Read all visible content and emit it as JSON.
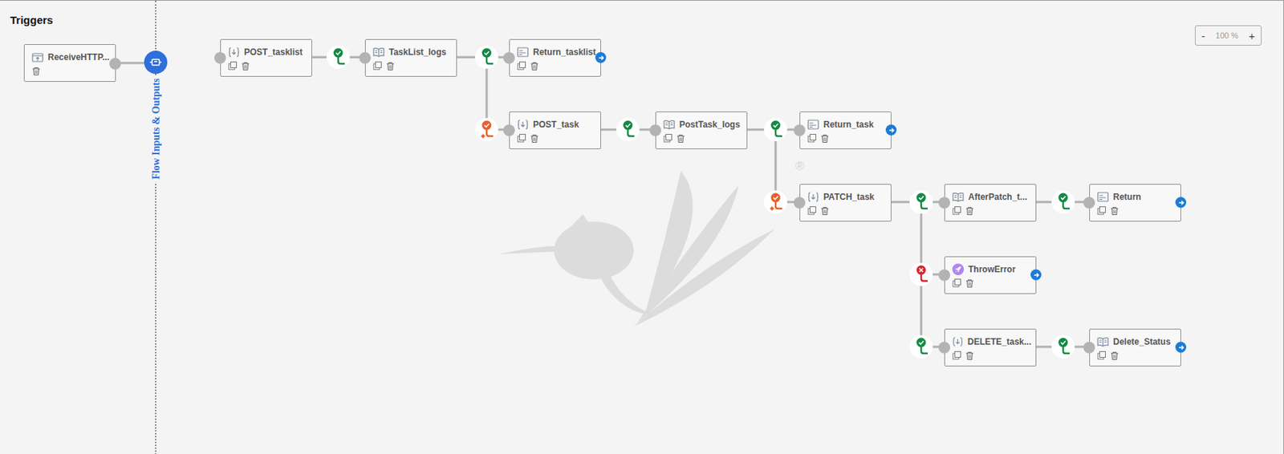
{
  "triggers": {
    "title": "Triggers",
    "items": [
      {
        "label": "ReceiveHTTP..."
      }
    ]
  },
  "flow_io": {
    "label": "Flow Inputs & Outputs"
  },
  "watermark": {
    "mark": "®"
  },
  "zoom": {
    "minus": "-",
    "value": "100 %",
    "plus": "+"
  },
  "nodes": [
    {
      "label": "POST_tasklist",
      "kind": "mapper",
      "returns": false
    },
    {
      "label": "TaskList_logs",
      "kind": "log",
      "returns": false
    },
    {
      "label": "Return_tasklist",
      "kind": "return",
      "returns": true
    },
    {
      "label": "POST_task",
      "kind": "mapper",
      "returns": false
    },
    {
      "label": "PostTask_logs",
      "kind": "log",
      "returns": false
    },
    {
      "label": "Return_task",
      "kind": "return",
      "returns": true
    },
    {
      "label": "PATCH_task",
      "kind": "mapper",
      "returns": false
    },
    {
      "label": "AfterPatch_t...",
      "kind": "log",
      "returns": false
    },
    {
      "label": "Return",
      "kind": "return",
      "returns": true
    },
    {
      "label": "ThrowError",
      "kind": "throw",
      "returns": true
    },
    {
      "label": "DELETE_task...",
      "kind": "mapper",
      "returns": false
    },
    {
      "label": "Delete_Status",
      "kind": "log",
      "returns": true
    }
  ],
  "branches": [
    {
      "kind": "success"
    },
    {
      "kind": "success"
    },
    {
      "kind": "condition"
    },
    {
      "kind": "success"
    },
    {
      "kind": "success"
    },
    {
      "kind": "condition"
    },
    {
      "kind": "success"
    },
    {
      "kind": "success"
    },
    {
      "kind": "error"
    },
    {
      "kind": "success"
    },
    {
      "kind": "success"
    }
  ]
}
